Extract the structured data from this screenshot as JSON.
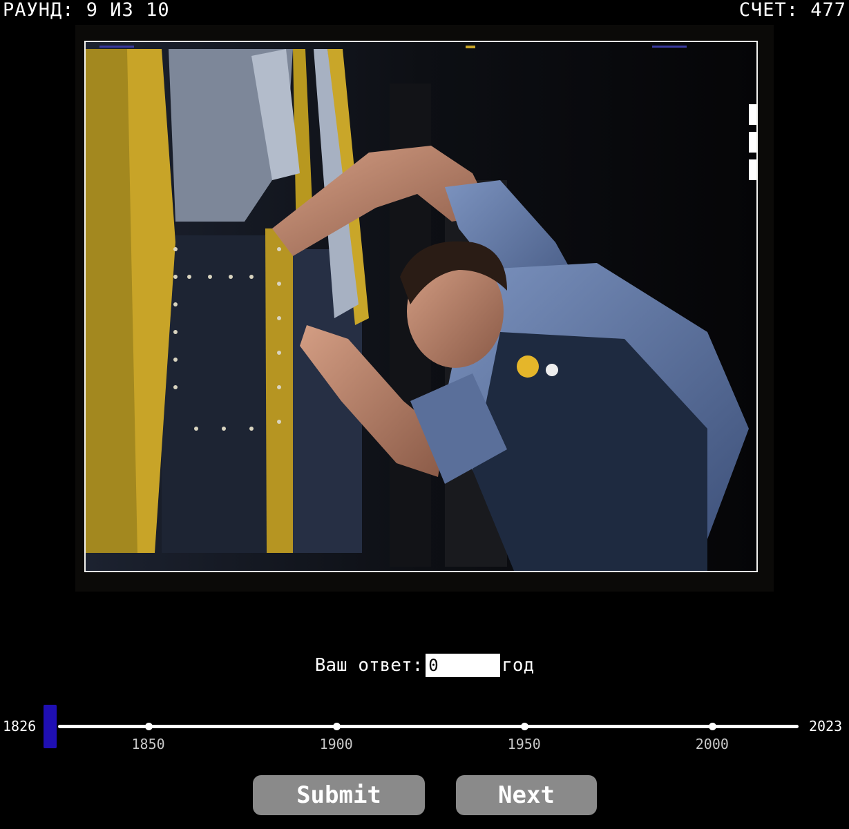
{
  "hud": {
    "round_text": "РАУНД: 9 ИЗ 10",
    "score_text": "СЧЕТ: 477"
  },
  "photo": {
    "subject": "photograph"
  },
  "answer": {
    "label": "Ваш ответ:",
    "value": "0",
    "unit": "год"
  },
  "timeline": {
    "min_label": "1826",
    "max_label": "2023",
    "min": 1826,
    "max": 2023,
    "selected": 1826,
    "ticks": [
      {
        "year": 1850,
        "label": "1850"
      },
      {
        "year": 1900,
        "label": "1900"
      },
      {
        "year": 1950,
        "label": "1950"
      },
      {
        "year": 2000,
        "label": "2000"
      }
    ],
    "handle_color": "#1f0fb3"
  },
  "buttons": {
    "submit_label": "Submit",
    "next_label": "Next"
  },
  "colors": {
    "background": "#000000",
    "button": "#8a8a8a",
    "text": "#ffffff"
  }
}
